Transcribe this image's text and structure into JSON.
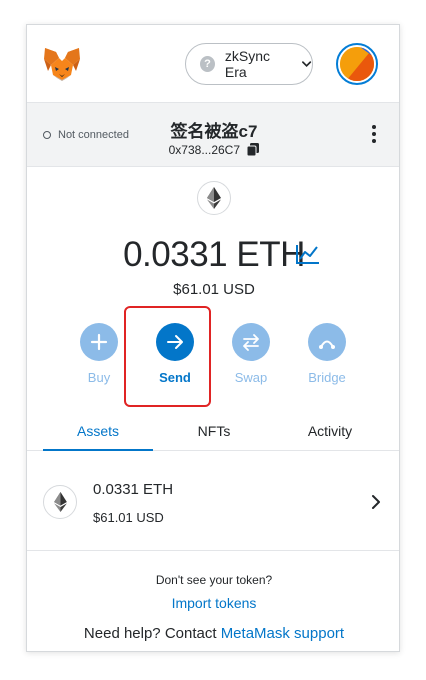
{
  "header": {
    "network_label": "zkSync Era",
    "network_icon": "?",
    "avatar_colors": [
      "#f59e0b",
      "#ea580c",
      "#2563eb"
    ]
  },
  "account": {
    "connection_status": "Not connected",
    "name": "签名被盗c7",
    "address": "0x738...26C7"
  },
  "balance": {
    "amount": "0.0331",
    "symbol": "ETH",
    "usd": "$61.01 USD"
  },
  "actions": [
    {
      "label": "Buy",
      "icon": "plus-icon"
    },
    {
      "label": "Send",
      "icon": "arrow-right-icon"
    },
    {
      "label": "Swap",
      "icon": "swap-icon"
    },
    {
      "label": "Bridge",
      "icon": "bridge-icon"
    }
  ],
  "tabs": [
    {
      "label": "Assets",
      "active": true
    },
    {
      "label": "NFTs",
      "active": false
    },
    {
      "label": "Activity",
      "active": false
    }
  ],
  "assets": [
    {
      "amount": "0.0331 ETH",
      "usd": "$61.01 USD"
    }
  ],
  "footer": {
    "dont_see": "Don't see your token?",
    "import_tokens": "Import tokens",
    "help_prefix": "Need help? Contact",
    "help_link": "MetaMask support"
  },
  "colors": {
    "accent": "#0376c9",
    "accent_light": "#8cbbe8",
    "highlight": "#e02424"
  }
}
